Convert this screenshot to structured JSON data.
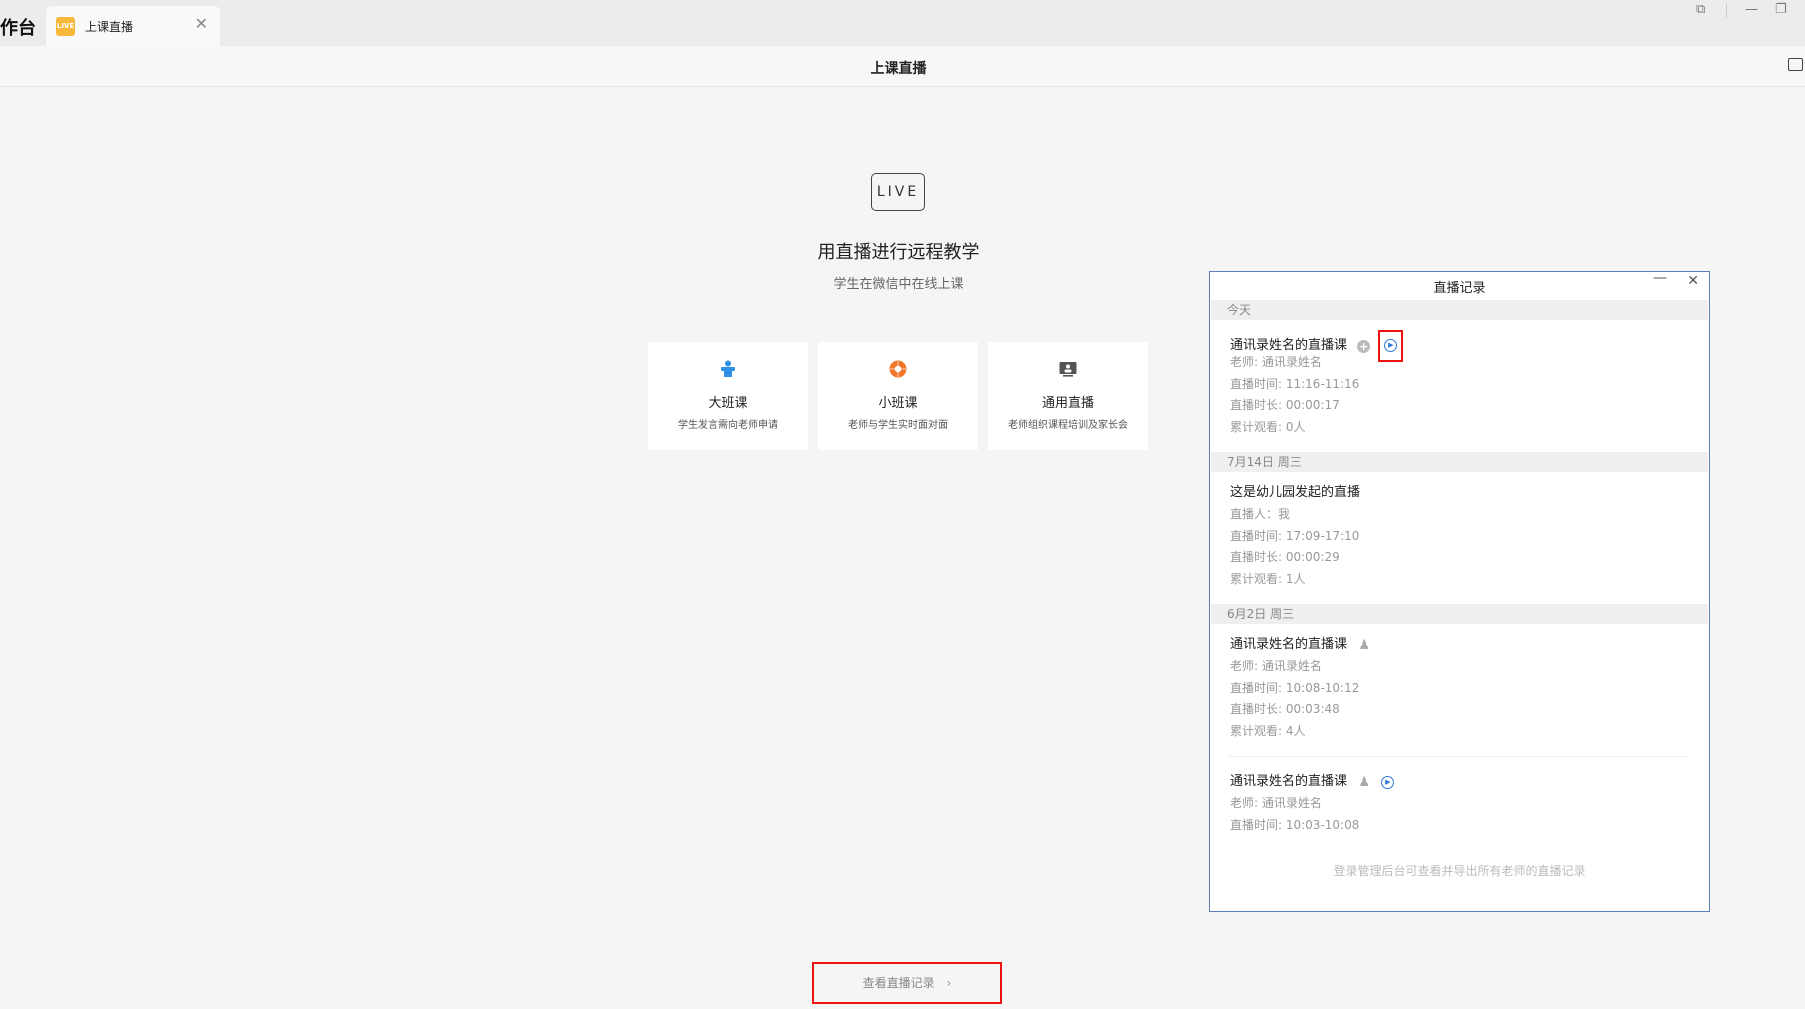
{
  "app": {
    "title": "作台"
  },
  "tab": {
    "logo": "LIVE",
    "label": "上课直播",
    "close": "✕"
  },
  "window_controls": [
    "⧉",
    "—",
    "❐"
  ],
  "header": {
    "title": "上课直播"
  },
  "hero": {
    "badge": "LIVE",
    "title": "用直播进行远程教学",
    "subtitle": "学生在微信中在线上课"
  },
  "cards": [
    {
      "name": "大班课",
      "desc": "学生发言需向老师申请",
      "icon": "big-class-icon",
      "color": "#2f8ee8"
    },
    {
      "name": "小班课",
      "desc": "老师与学生实时面对面",
      "icon": "small-class-icon",
      "color": "#f0762a"
    },
    {
      "name": "通用直播",
      "desc": "老师组织课程培训及家长会",
      "icon": "general-live-icon",
      "color": "#555555"
    }
  ],
  "view_records": {
    "label": "查看直播记录",
    "arrow": "›"
  },
  "popup": {
    "title": "直播记录",
    "footer": "登录管理后台可查看并导出所有老师的直播记录",
    "groups": [
      {
        "date": "今天",
        "records": [
          {
            "title": "通讯录姓名的直播课",
            "lines": [
              "老师: 通讯录姓名",
              "直播时间: 11:16-11:16",
              "直播时长: 00:00:17",
              "累计观看: 0人"
            ]
          }
        ]
      },
      {
        "date": "7月14日 周三",
        "records": [
          {
            "title": "这是幼儿园发起的直播",
            "lines": [
              "直播人：我",
              "直播时间: 17:09-17:10",
              "直播时长: 00:00:29",
              "累计观看: 1人"
            ]
          }
        ]
      },
      {
        "date": "6月2日 周三",
        "records": [
          {
            "title": "通讯录姓名的直播课",
            "lines": [
              "老师: 通讯录姓名",
              "直播时间: 10:08-10:12",
              "直播时长: 00:03:48",
              "累计观看: 4人"
            ]
          },
          {
            "title": "通讯录姓名的直播课",
            "lines": [
              "老师: 通讯录姓名",
              "直播时间: 10:03-10:08"
            ]
          }
        ]
      }
    ]
  }
}
